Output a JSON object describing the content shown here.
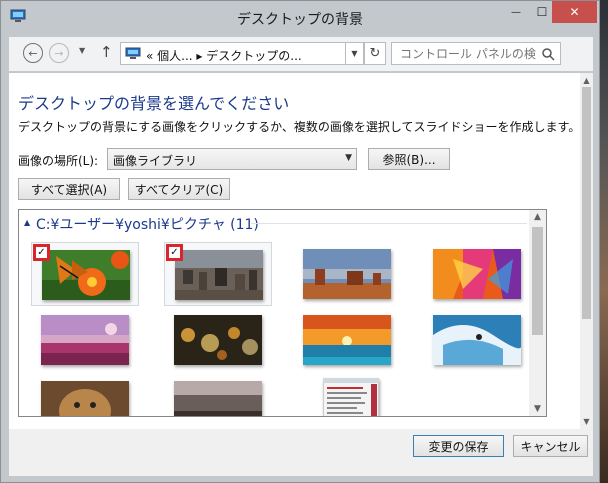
{
  "window": {
    "title": "デスクトップの背景",
    "controls": {
      "minimize": "—",
      "maximize": "☐",
      "close": "✕"
    }
  },
  "address": {
    "breadcrumb": "« 個人... ▸ デスクトップの...",
    "search_placeholder": "コントロール パネルの検索"
  },
  "content": {
    "heading": "デスクトップの背景を選んでください",
    "description": "デスクトップの背景にする画像をクリックするか、複数の画像を選択してスライドショーを作成します。",
    "location_label": "画像の場所(L):",
    "location_value": "画像ライブラリ",
    "browse_button": "参照(B)...",
    "select_all_button": "すべて選択(A)",
    "clear_all_button": "すべてクリア(C)"
  },
  "gallery": {
    "group_title": "C:¥ユーザー¥yoshi¥ピクチャ (11)",
    "images": [
      {
        "name": "butterfly",
        "selected": true
      },
      {
        "name": "city-aerial",
        "selected": true
      },
      {
        "name": "monument-valley",
        "selected": false
      },
      {
        "name": "abstract-orange",
        "selected": false
      },
      {
        "name": "tulip-field",
        "selected": false
      },
      {
        "name": "bokeh-lights",
        "selected": false
      },
      {
        "name": "sunset-sea",
        "selected": false
      },
      {
        "name": "surfer",
        "selected": false
      },
      {
        "name": "cheetah",
        "selected": false
      },
      {
        "name": "dark-landscape",
        "selected": false
      },
      {
        "name": "screenshot-menu",
        "selected": false
      }
    ]
  },
  "footer": {
    "save_button": "変更の保存",
    "cancel_button": "キャンセル"
  },
  "colors": {
    "heading": "#1b3a8c",
    "check": "#d9262c",
    "close_button": "#c7504c"
  }
}
